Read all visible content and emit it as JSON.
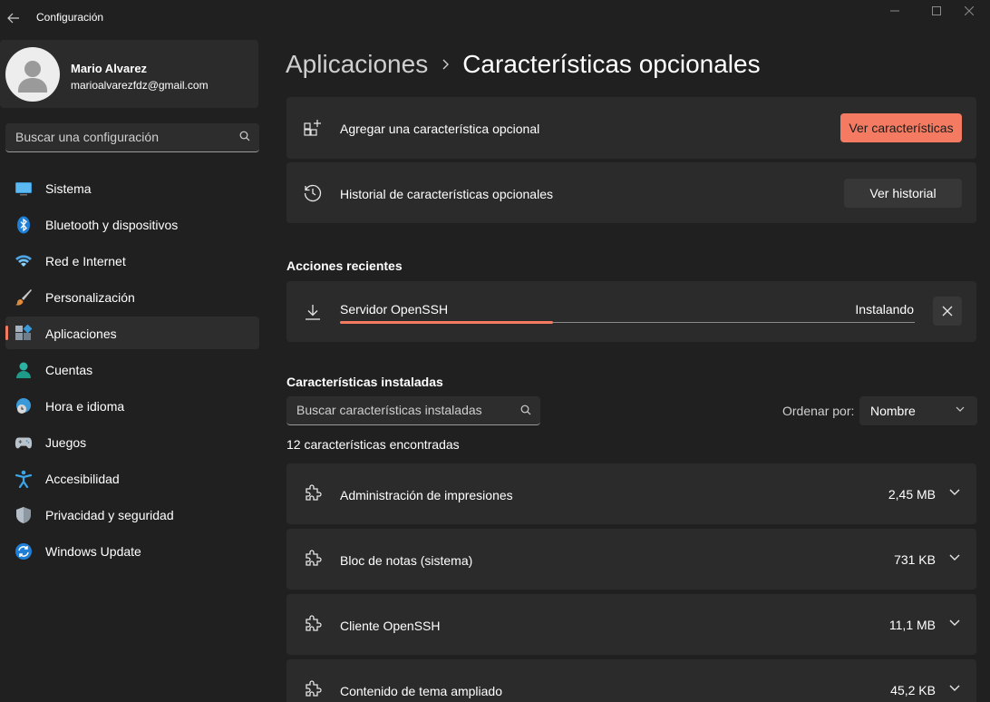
{
  "window": {
    "title": "Configuración",
    "back_icon": "back-arrow-icon",
    "controls": [
      "minimize-icon",
      "maximize-icon",
      "close-icon"
    ]
  },
  "profile": {
    "name": "Mario Alvarez",
    "email": "marioalvarezfdz@gmail.com"
  },
  "sidebar": {
    "search_placeholder": "Buscar una configuración",
    "items": [
      {
        "label": "Sistema",
        "icon": "system-monitor-icon",
        "active": false
      },
      {
        "label": "Bluetooth y dispositivos",
        "icon": "bluetooth-icon",
        "active": false
      },
      {
        "label": "Red e Internet",
        "icon": "wifi-icon",
        "active": false
      },
      {
        "label": "Personalización",
        "icon": "paintbrush-icon",
        "active": false
      },
      {
        "label": "Aplicaciones",
        "icon": "apps-icon",
        "active": true
      },
      {
        "label": "Cuentas",
        "icon": "person-icon",
        "active": false
      },
      {
        "label": "Hora e idioma",
        "icon": "clock-globe-icon",
        "active": false
      },
      {
        "label": "Juegos",
        "icon": "gamepad-icon",
        "active": false
      },
      {
        "label": "Accesibilidad",
        "icon": "accessibility-icon",
        "active": false
      },
      {
        "label": "Privacidad y seguridad",
        "icon": "shield-icon",
        "active": false
      },
      {
        "label": "Windows Update",
        "icon": "update-sync-icon",
        "active": false
      }
    ]
  },
  "breadcrumb": {
    "parent": "Aplicaciones",
    "current": "Características opcionales"
  },
  "actions": {
    "add": {
      "label": "Agregar una característica opcional",
      "button": "Ver características",
      "icon": "add-grid-icon"
    },
    "history": {
      "label": "Historial de características opcionales",
      "button": "Ver historial",
      "icon": "history-icon"
    }
  },
  "recent": {
    "title": "Acciones recientes",
    "item": {
      "name": "Servidor OpenSSH",
      "status": "Instalando",
      "progress": 0.37,
      "icon": "download-icon"
    }
  },
  "installed": {
    "title": "Características instaladas",
    "search_placeholder": "Buscar características instaladas",
    "sort_label": "Ordenar por:",
    "sort_value": "Nombre",
    "count_text": "12 características encontradas",
    "features": [
      {
        "name": "Administración de impresiones",
        "size": "2,45 MB"
      },
      {
        "name": "Bloc de notas (sistema)",
        "size": "731 KB"
      },
      {
        "name": "Cliente OpenSSH",
        "size": "11,1 MB"
      },
      {
        "name": "Contenido de tema ampliado",
        "size": "45,2 KB"
      }
    ]
  },
  "colors": {
    "accent": "#f47b61",
    "background": "#202020",
    "card": "#2b2b2b"
  }
}
